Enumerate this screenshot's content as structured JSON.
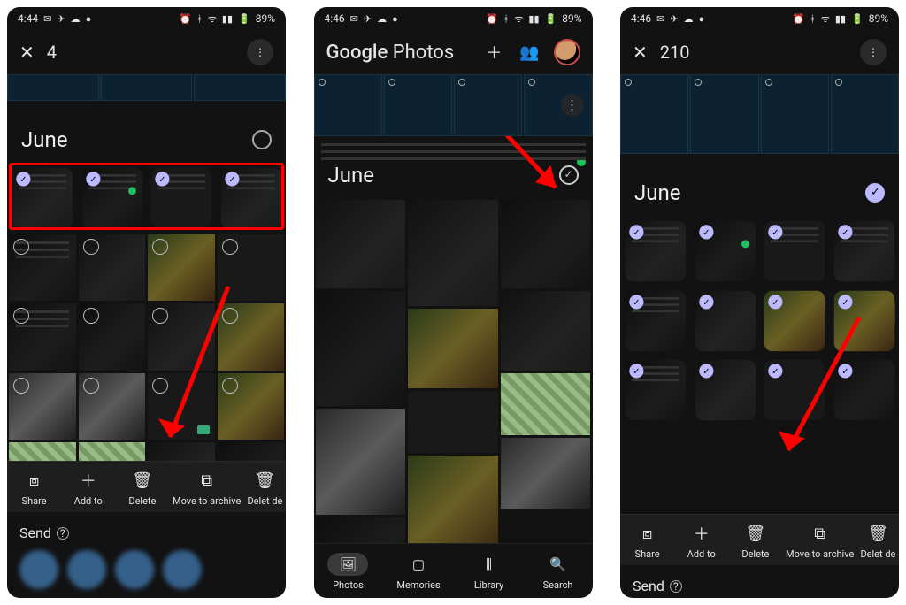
{
  "statusbar": {
    "time_a": "4:44",
    "time_b": "4:46",
    "time_c": "4:46",
    "battery": "89%"
  },
  "phone1": {
    "selection_count": "4",
    "section": "June",
    "actions": {
      "share": "Share",
      "addto": "Add to",
      "delete": "Delete",
      "archive": "Move to archive",
      "delete2": "Delet\nde"
    },
    "send_label": "Send"
  },
  "phone2": {
    "app_title_bold": "Google",
    "app_title": " Photos",
    "section": "June",
    "nav": {
      "photos": "Photos",
      "memories": "Memories",
      "library": "Library",
      "search": "Search"
    }
  },
  "phone3": {
    "selection_count": "210",
    "section": "June",
    "actions": {
      "share": "Share",
      "addto": "Add to",
      "delete": "Delete",
      "archive": "Move to archive",
      "delete2": "Delet\nde"
    },
    "send_label": "Send"
  }
}
